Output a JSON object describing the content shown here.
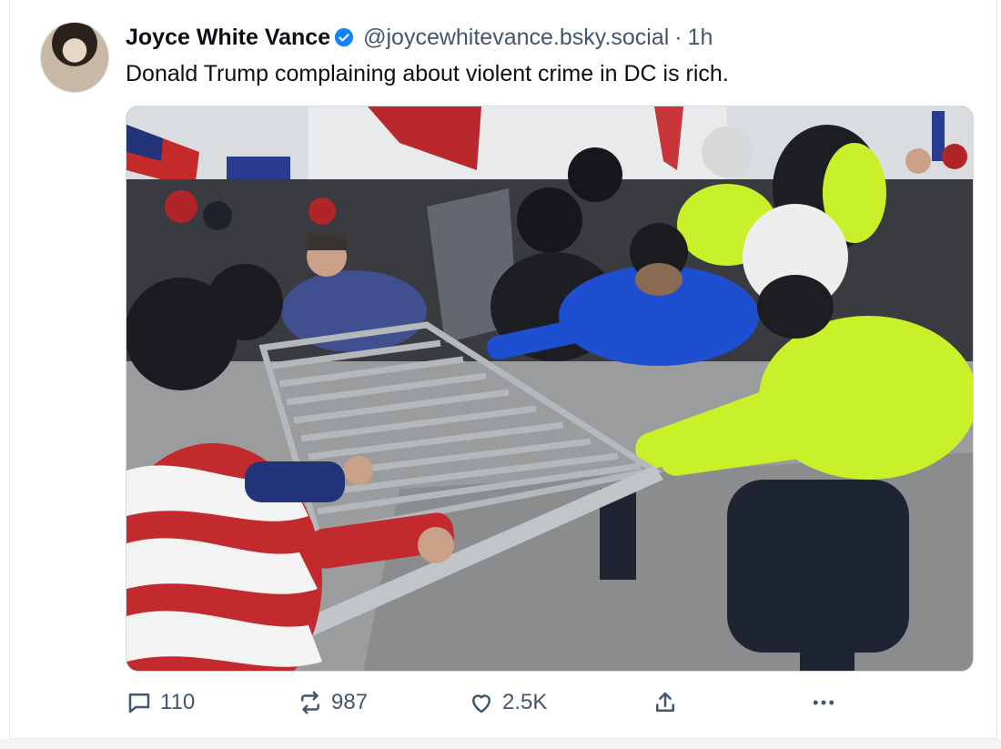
{
  "post": {
    "author_name": "Joyce White Vance",
    "handle": "@joycewhitevance.bsky.social",
    "separator": "·",
    "time": "1h",
    "text": "Donald Trump complaining about violent crime in DC is rich."
  },
  "actions": {
    "replies": "110",
    "reposts": "987",
    "likes": "2.5K"
  },
  "colors": {
    "verified": "#1083fe",
    "secondary_text": "#42576c",
    "police_hi_vis": "#c8f12a",
    "police_blue": "#1e4fd0"
  },
  "icons": [
    "verified-badge-icon",
    "reply-icon",
    "repost-icon",
    "like-icon",
    "share-icon",
    "more-icon"
  ]
}
